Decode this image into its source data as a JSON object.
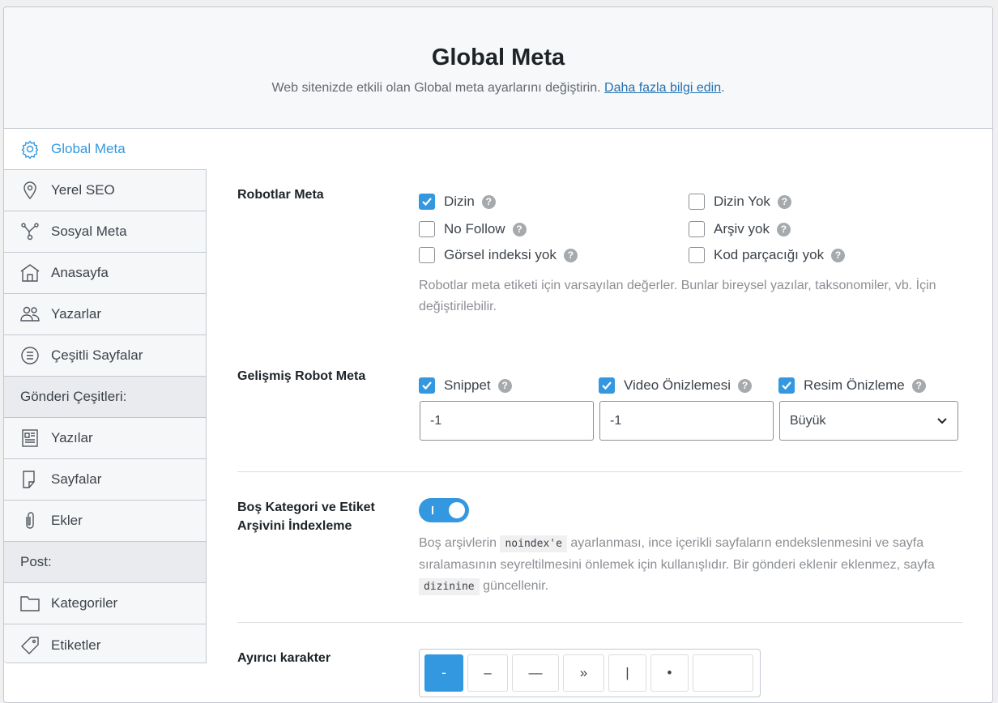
{
  "header": {
    "title": "Global Meta",
    "subtitle": "Web sitenizde etkili olan Global meta ayarlarını değiştirin.",
    "link": "Daha fazla bilgi edin",
    "link_suffix": "."
  },
  "sidebar": {
    "items": [
      {
        "label": "Global Meta",
        "icon": "gear-icon",
        "active": true
      },
      {
        "label": "Yerel SEO",
        "icon": "map-pin-icon"
      },
      {
        "label": "Sosyal Meta",
        "icon": "share-nodes-icon"
      },
      {
        "label": "Anasayfa",
        "icon": "home-icon"
      },
      {
        "label": "Yazarlar",
        "icon": "users-icon"
      },
      {
        "label": "Çeşitli Sayfalar",
        "icon": "list-circle-icon"
      }
    ],
    "section1": "Gönderi Çeşitleri:",
    "post_types": [
      {
        "label": "Yazılar",
        "icon": "document-icon"
      },
      {
        "label": "Sayfalar",
        "icon": "page-icon"
      },
      {
        "label": "Ekler",
        "icon": "paperclip-icon"
      }
    ],
    "section2": "Post:",
    "taxonomies": [
      {
        "label": "Kategoriler",
        "icon": "folder-icon"
      },
      {
        "label": "Etiketler",
        "icon": "tag-icon"
      }
    ]
  },
  "robots": {
    "label": "Robotlar Meta",
    "options": [
      {
        "label": "Dizin",
        "checked": true
      },
      {
        "label": "Dizin Yok",
        "checked": false
      },
      {
        "label": "No Follow",
        "checked": false
      },
      {
        "label": "Arşiv yok",
        "checked": false
      },
      {
        "label": "Görsel indeksi yok",
        "checked": false
      },
      {
        "label": "Kod parçacığı yok",
        "checked": false
      }
    ],
    "description": "Robotlar meta etiketi için varsayılan değerler. Bunlar bireysel yazılar, taksonomiler, vb. İçin değiştirilebilir."
  },
  "advanced": {
    "label": "Gelişmiş Robot Meta",
    "snippet": {
      "label": "Snippet",
      "checked": true,
      "value": "-1"
    },
    "video": {
      "label": "Video Önizlemesi",
      "checked": true,
      "value": "-1"
    },
    "image": {
      "label": "Resim Önizleme",
      "checked": true,
      "value": "Büyük"
    }
  },
  "empty_archive": {
    "label": "Boş Kategori ve Etiket Arşivini İndexleme",
    "enabled": true,
    "desc_1": "Boş arşivlerin",
    "code_1": "noindex'e",
    "desc_2": "ayarlanması, ince içerikli sayfaların endekslenmesini ve sayfa sıralamasının seyreltilmesini önlemek için kullanışlıdır. Bir gönderi eklenir eklenmez, sayfa",
    "code_2": "dizinine",
    "desc_3": "güncellenir."
  },
  "separator": {
    "label": "Ayırıcı karakter",
    "options": [
      "-",
      "–",
      "—",
      "»",
      "|",
      "•",
      ""
    ],
    "selected": "-"
  },
  "accent": "#3498e0"
}
